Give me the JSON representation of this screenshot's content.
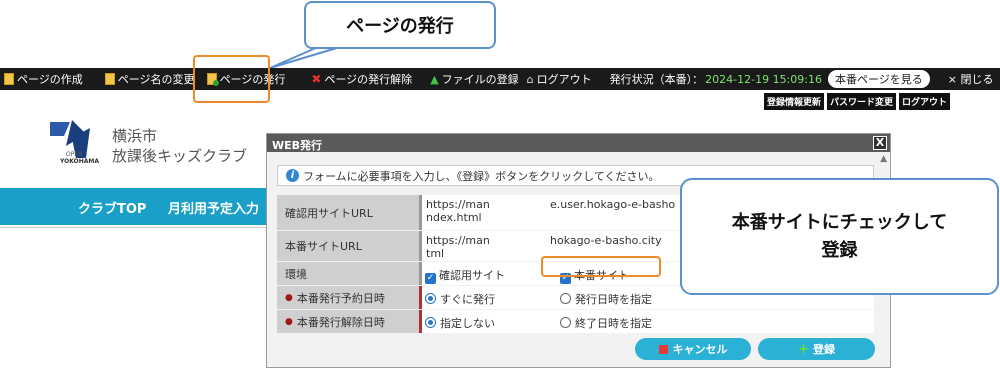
{
  "toolbar": {
    "create": "ページの作成",
    "rename": "ページ名の変更",
    "publish": "ページの発行",
    "unpublish": "ページの発行解除",
    "upload": "ファイルの登録",
    "logout": "ログアウト",
    "status_label": "発行状況（本番）：",
    "status_time": "2024-12-19 15:09:16",
    "view_prod": "本番ページを見る",
    "close": "× 閉じる"
  },
  "admin_buttons": [
    "登録情報更新",
    "パスワード変更",
    "ログアウト"
  ],
  "site": {
    "name_line1": "横浜市",
    "name_line2": "放課後キッズクラブ",
    "logo_open": "OPEN",
    "logo_yokohama": "YOKOHAMA",
    "nav": [
      "クラブTOP",
      "月利用予定入力"
    ]
  },
  "modal": {
    "title": "WEB発行",
    "close": "X",
    "notice": "フォームに必要事項を入力し、《登録》ボタンをクリックしてください。",
    "rows": {
      "staging_url": {
        "label": "確認用サイトURL",
        "value_a_line1": "https://man",
        "value_a_line2": "ndex.html",
        "value_b": "e.user.hokago-e-basho"
      },
      "prod_url": {
        "label": "本番サイトURL",
        "value_a_line1": "https://man",
        "value_a_line2": "tml",
        "value_b": "hokago-e-basho.city"
      },
      "env": {
        "label": "環境",
        "opt1": "確認用サイト",
        "opt2": "本番サイト"
      },
      "schedule": {
        "label": "本番発行予約日時",
        "opt1": "すぐに発行",
        "opt2": "発行日時を指定"
      },
      "unpublish": {
        "label": "本番発行解除日時",
        "opt1": "指定しない",
        "opt2": "終了日時を指定"
      }
    },
    "cancel": "キャンセル",
    "register": "登録"
  },
  "callouts": {
    "publish": "ページの発行",
    "check_line1": "本番サイトにチェックして",
    "check_line2": "登録"
  },
  "colors": {
    "toolbar_bg": "#1a1a1a",
    "nav_bg": "#1aa0c8",
    "button_bg": "#2bb0d6",
    "highlight": "#ef8a2a",
    "callout_border": "#5b8fce"
  }
}
